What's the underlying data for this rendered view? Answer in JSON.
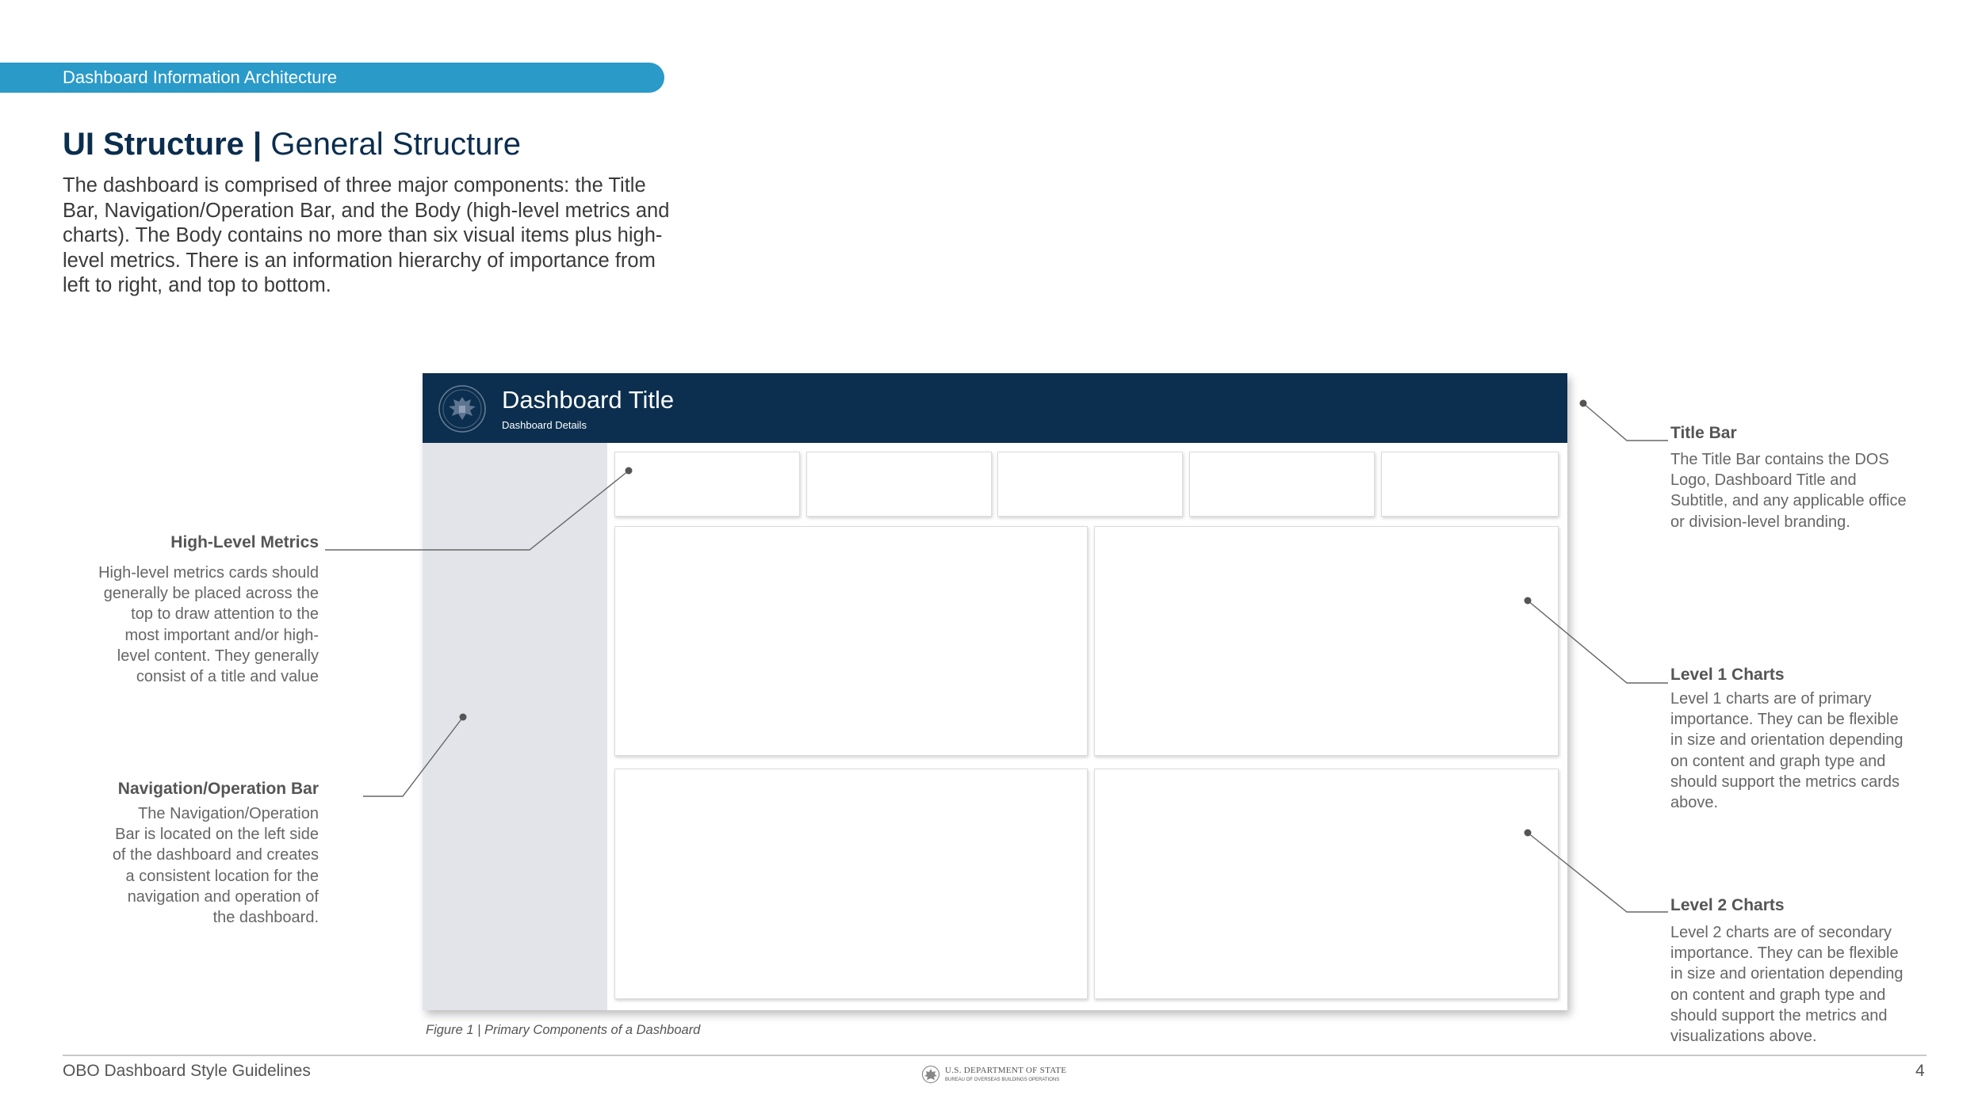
{
  "section_tab": "Dashboard Information Architecture",
  "heading": {
    "bold": "UI Structure |",
    "light": " General Structure"
  },
  "intro": "The dashboard is comprised of three major components: the Title Bar, Navigation/Operation Bar, and the Body (high-level metrics and charts). The Body contains no more than six visual items plus high-level metrics. There is an information hierarchy of importance from left to right, and top to bottom.",
  "mockup": {
    "title": "Dashboard Title",
    "subtitle": "Dashboard Details",
    "metric_cards": 5,
    "level1_charts": 2,
    "level2_charts": 2
  },
  "annotations": {
    "high_level_metrics": {
      "title": "High-Level Metrics",
      "lines": [
        "High-level metrics cards should",
        "generally be placed across the",
        "top to draw attention to the",
        "most important and/or high-",
        "level content. They generally",
        "consist of a title and value"
      ]
    },
    "navigation_bar": {
      "title": "Navigation/Operation Bar",
      "lines": [
        "The Navigation/Operation",
        "Bar is located on the left side",
        "of the dashboard and creates",
        "a consistent location for the",
        "navigation and operation of",
        "the dashboard."
      ]
    },
    "title_bar": {
      "title": "Title Bar",
      "lines": [
        "The Title Bar contains the DOS",
        "Logo, Dashboard Title and",
        "Subtitle, and any applicable office",
        "or division-level branding."
      ]
    },
    "level1_charts": {
      "title": "Level 1 Charts",
      "lines": [
        "Level 1 charts are of primary",
        "importance. They can be flexible",
        "in size and orientation depending",
        "on content and graph type and",
        "should support the metrics cards",
        "above."
      ]
    },
    "level2_charts": {
      "title": "Level 2 Charts",
      "lines": [
        "Level 2 charts are of secondary",
        "importance. They can be flexible",
        "in size and orientation depending",
        "on content and graph type and",
        "should support the metrics and",
        "visualizations above."
      ]
    }
  },
  "caption": "Figure 1 | Primary Components of a Dashboard",
  "footer": {
    "left": "OBO Dashboard Style Guidelines",
    "logo_line1": "U.S. DEPARTMENT OF STATE",
    "logo_line2": "BUREAU OF OVERSEAS BUILDINGS OPERATIONS",
    "page_number": "4"
  },
  "colors": {
    "accent": "#2a9ac9",
    "navy": "#0c2f4f",
    "nav_bar": "#e3e4e9"
  },
  "icons": [
    "department-of-state-seal-icon"
  ]
}
